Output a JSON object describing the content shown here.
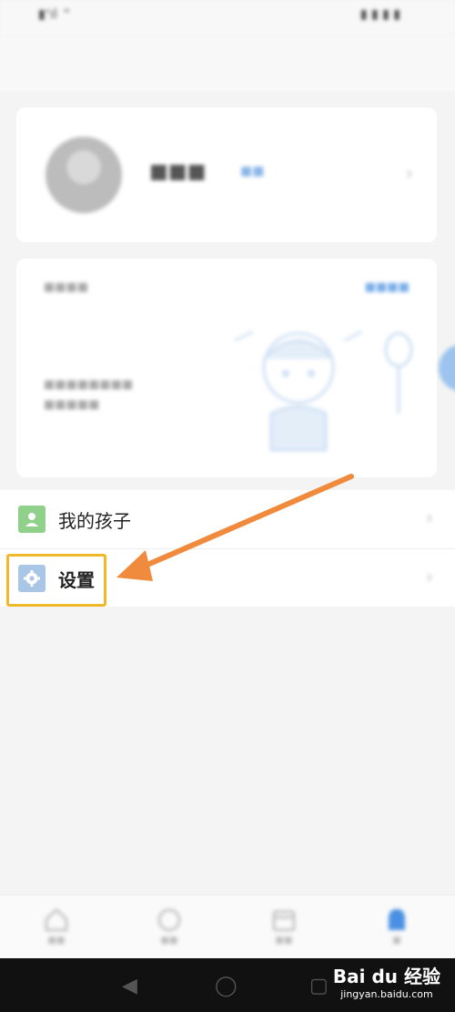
{
  "status_bar": {
    "left_text": "▮ᐩıl ⌃",
    "right_text": "▮ ▮ ▮ ▮"
  },
  "profile": {
    "name": "■■■",
    "tag": "■■"
  },
  "info_card": {
    "title": "■■■■",
    "link": "■■■■",
    "description": "■■■■■■■■ ■■■■■"
  },
  "menu": {
    "items": [
      {
        "label": "我的孩子",
        "icon": "child-profile-icon",
        "icon_color": "#8fd08a"
      },
      {
        "label": "设置",
        "icon": "gear-icon",
        "icon_color": "#a9c6e6"
      }
    ]
  },
  "annotation": {
    "arrow_color": "#f08a3c",
    "highlight_color": "#f1b92a"
  },
  "tabs": [
    {
      "label": "■■",
      "icon": "home-icon"
    },
    {
      "label": "■■",
      "icon": "circle-icon"
    },
    {
      "label": "■■",
      "icon": "calendar-icon"
    },
    {
      "label": "■",
      "icon": "person-icon",
      "active": true
    }
  ],
  "nav_bar": {
    "back": "◀",
    "home": "◯",
    "recent": "▢"
  },
  "watermark": {
    "line1": "Bai du 经验",
    "line2": "jingyan.baidu.com"
  }
}
